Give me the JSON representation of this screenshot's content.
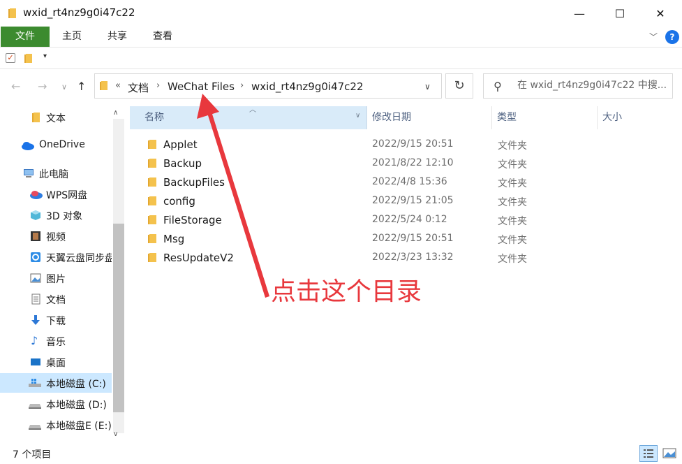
{
  "window": {
    "title": "wxid_rt4nz9g0i47c22",
    "minimize": "—",
    "maximize": "☐",
    "close": "✕"
  },
  "ribbon": {
    "tabs": [
      {
        "label": "文件"
      },
      {
        "label": "主页"
      },
      {
        "label": "共享"
      },
      {
        "label": "查看"
      }
    ],
    "expand_icon": "chevron-down-icon",
    "help_label": "?"
  },
  "nav": {
    "breadcrumb_prefix": "«",
    "breadcrumbs": [
      "文档",
      "WeChat Files",
      "wxid_rt4nz9g0i47c22"
    ],
    "search_placeholder": "在 wxid_rt4nz9g0i47c22 中搜..."
  },
  "sidebar": {
    "items": [
      {
        "label": "文本",
        "icon": "folder-icon"
      },
      {
        "label": "OneDrive",
        "icon": "cloud-icon"
      },
      {
        "label": "此电脑",
        "icon": "computer-icon"
      },
      {
        "label": "WPS网盘",
        "icon": "wps-cloud-icon"
      },
      {
        "label": "3D 对象",
        "icon": "cube-icon"
      },
      {
        "label": "视频",
        "icon": "film-icon"
      },
      {
        "label": "天翼云盘同步盘",
        "icon": "sync-icon"
      },
      {
        "label": "图片",
        "icon": "picture-icon"
      },
      {
        "label": "文档",
        "icon": "document-icon"
      },
      {
        "label": "下载",
        "icon": "download-icon"
      },
      {
        "label": "音乐",
        "icon": "music-icon"
      },
      {
        "label": "桌面",
        "icon": "desktop-icon"
      },
      {
        "label": "本地磁盘 (C:)",
        "icon": "drive-c-icon"
      },
      {
        "label": "本地磁盘 (D:)",
        "icon": "drive-icon"
      },
      {
        "label": "本地磁盘E (E:)",
        "icon": "drive-icon"
      }
    ]
  },
  "columns": {
    "name": "名称",
    "date": "修改日期",
    "type": "类型",
    "size": "大小"
  },
  "files": [
    {
      "name": "Applet",
      "date": "2022/9/15 20:51",
      "type": "文件夹"
    },
    {
      "name": "Backup",
      "date": "2021/8/22 12:10",
      "type": "文件夹"
    },
    {
      "name": "BackupFiles",
      "date": "2022/4/8 15:36",
      "type": "文件夹"
    },
    {
      "name": "config",
      "date": "2022/9/15 21:05",
      "type": "文件夹"
    },
    {
      "name": "FileStorage",
      "date": "2022/5/24 0:12",
      "type": "文件夹"
    },
    {
      "name": "Msg",
      "date": "2022/9/15 20:51",
      "type": "文件夹"
    },
    {
      "name": "ResUpdateV2",
      "date": "2022/3/23 13:32",
      "type": "文件夹"
    }
  ],
  "annotation": {
    "text": "点击这个目录",
    "color": "#e8383d"
  },
  "status": {
    "item_count": "7 个项目"
  },
  "colors": {
    "file_tab": "#3c8b2f",
    "selection": "#cce8ff",
    "header_active": "#d9ebf9",
    "folder": "#f4c24d"
  }
}
